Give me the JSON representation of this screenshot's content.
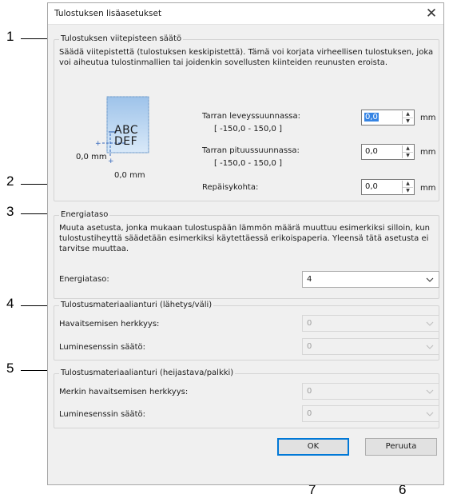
{
  "dialog": {
    "title": "Tulostuksen lisäasetukset",
    "close_glyph": "✕"
  },
  "reference_point": {
    "group_title": "Tulostuksen viitepisteen säätö",
    "description": "Säädä viitepistettä (tulostuksen keskipistettä). Tämä voi korjata virheellisen tulostuksen, joka voi aiheutua tulostinmallien tai joidenkin sovellusten kiinteiden reunusten eroista.",
    "preview": {
      "sample_line1": "ABC",
      "sample_line2": "DEF",
      "x_offset_label": "0,0 mm",
      "y_offset_label": "0,0 mm"
    },
    "width_label": "Tarran leveyssuunnassa:",
    "width_range": "[ -150,0 - 150,0 ]",
    "width_value": "0,0",
    "length_label": "Tarran pituussuunnassa:",
    "length_range": "[ -150,0 - 150,0 ]",
    "length_value": "0,0",
    "tear_label": "Repäisykohta:",
    "tear_value": "0,0",
    "unit": "mm"
  },
  "energy": {
    "group_title": "Energiataso",
    "description": "Muuta asetusta, jonka mukaan tulostuspään lämmön määrä muuttuu esimerkiksi silloin, kun tulostustiheyttä säädetään esimerkiksi käytettäessä erikoispaperia. Yleensä tätä asetusta ei tarvitse muuttaa.",
    "label": "Energiataso:",
    "value": "4"
  },
  "sensor_gap": {
    "group_title": "Tulostusmateriaalianturi (lähetys/väli)",
    "sensitivity_label": "Havaitsemisen herkkyys:",
    "sensitivity_value": "0",
    "luminescence_label": "Luminesenssin säätö:",
    "luminescence_value": "0"
  },
  "sensor_mark": {
    "group_title": "Tulostusmateriaalianturi (heijastava/palkki)",
    "sensitivity_label": "Merkin havaitsemisen herkkyys:",
    "sensitivity_value": "0",
    "luminescence_label": "Luminesenssin säätö:",
    "luminescence_value": "0"
  },
  "buttons": {
    "ok": "OK",
    "cancel": "Peruuta"
  },
  "callouts": [
    "1",
    "2",
    "3",
    "4",
    "5",
    "6",
    "7"
  ],
  "icons": {
    "spin_up": "▲",
    "spin_down": "▼",
    "dropdown": "chevron-down-icon"
  }
}
